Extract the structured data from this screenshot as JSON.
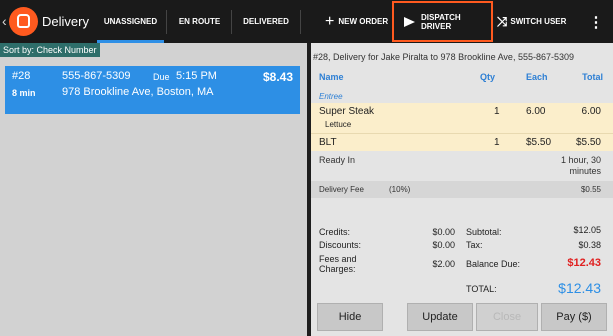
{
  "topbar": {
    "title": "Delivery",
    "tabs": [
      {
        "label": "UNASSIGNED"
      },
      {
        "label": "EN ROUTE"
      },
      {
        "label": "DELIVERED"
      }
    ],
    "actions": {
      "new_order": "NEW ORDER",
      "dispatch_driver": "DISPATCH DRIVER",
      "switch_user": "SWITCH USER"
    },
    "accent_color": "#ff5a1f",
    "tab_underline_color": "#2e8fe6"
  },
  "left": {
    "sort_label": "Sort by: Check Number",
    "orders": [
      {
        "number": "#28",
        "phone": "555-867-5309",
        "due_label": "Due",
        "due_time": "5:15 PM",
        "total": "$8.43",
        "elapsed": "8 min",
        "address": "978 Brookline Ave, Boston, MA"
      }
    ]
  },
  "detail": {
    "header": "#28, Delivery for Jake Piralta to 978 Brookline Ave, 555-867-5309",
    "columns": {
      "name": "Name",
      "qty": "Qty",
      "each": "Each",
      "total": "Total"
    },
    "section": "Entree",
    "items": [
      {
        "name": "Super Steak",
        "modifier": "Lettuce",
        "qty": "1",
        "each": "6.00",
        "total": "6.00"
      },
      {
        "name": "BLT",
        "modifier": "",
        "qty": "1",
        "each": "$5.50",
        "total": "$5.50"
      }
    ],
    "ready_in_label": "Ready In",
    "ready_in_value_line1": "1 hour, 30",
    "ready_in_value_line2": "minutes",
    "delivery_fee_label": "Delivery Fee",
    "delivery_fee_pct": "(10%)",
    "delivery_fee_value": "$0.55",
    "totals": {
      "credits_label": "Credits:",
      "credits": "$0.00",
      "discounts_label": "Discounts:",
      "discounts": "$0.00",
      "fees_label_1": "Fees and",
      "fees_label_2": "Charges:",
      "fees": "$2.00",
      "subtotal_label": "Subtotal:",
      "subtotal": "$12.05",
      "tax_label": "Tax:",
      "tax": "$0.38",
      "balance_label": "Balance Due:",
      "balance": "$12.43",
      "total_label": "TOTAL:",
      "total": "$12.43"
    },
    "buttons": {
      "hide": "Hide",
      "update": "Update",
      "close": "Close",
      "pay": "Pay ($)"
    }
  }
}
